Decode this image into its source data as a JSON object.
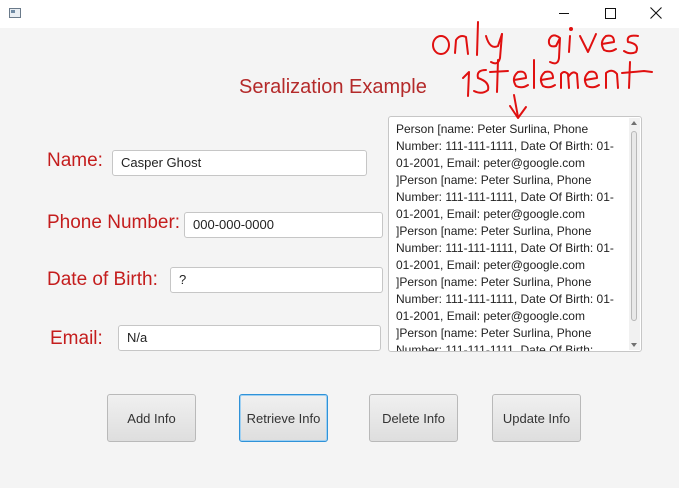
{
  "window": {
    "minimize_icon": "minimize-icon",
    "maximize_icon": "maximize-icon",
    "close_icon": "close-icon"
  },
  "app": {
    "title": "Seralization Example"
  },
  "form": {
    "name_label": "Name:",
    "name_value": "Casper Ghost",
    "phone_label": "Phone Number:",
    "phone_value": "000-000-0000",
    "dob_label": "Date of Birth:",
    "dob_value": "?",
    "email_label": "Email:",
    "email_value": "N/a"
  },
  "output": {
    "text": "Person [name: Peter Surlina, Phone Number: 111-111-1111, Date Of Birth: 01-01-2001, Email: peter@google.com ]Person [name: Peter Surlina, Phone Number: 111-111-1111, Date Of Birth: 01-01-2001, Email: peter@google.com ]Person [name: Peter Surlina, Phone Number: 111-111-1111, Date Of Birth: 01-01-2001, Email: peter@google.com ]Person [name: Peter Surlina, Phone Number: 111-111-1111, Date Of Birth: 01-01-2001, Email: peter@google.com ]Person [name: Peter Surlina, Phone Number: 111-111-1111, Date Of Birth:"
  },
  "buttons": {
    "add": "Add Info",
    "retrieve": "Retrieve Info",
    "delete": "Delete Info",
    "update": "Update Info"
  },
  "annotation": {
    "text": "only gives 1st element",
    "color": "#e01010"
  },
  "colors": {
    "label": "#c41d1d",
    "title": "#b42a2a",
    "focus": "#2f92d8"
  }
}
